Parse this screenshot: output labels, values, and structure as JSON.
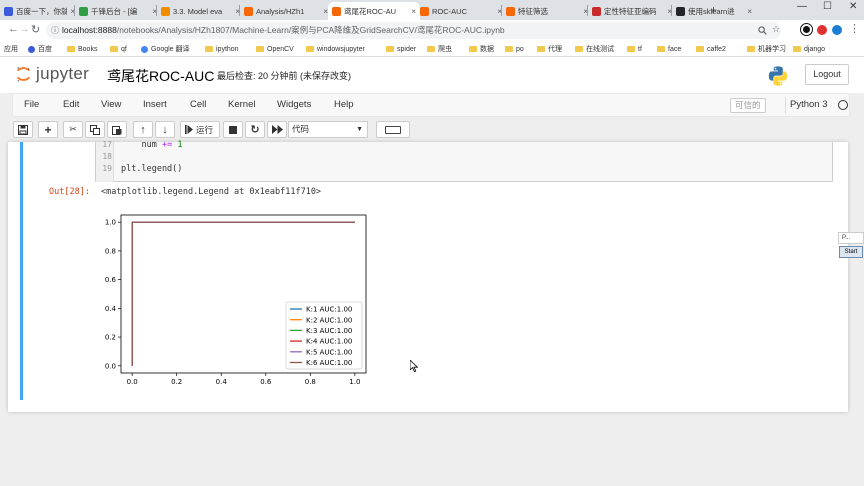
{
  "browser": {
    "tabs": [
      {
        "title": "百度一下，你就",
        "favicon_color": "#3b5bdb",
        "active": false
      },
      {
        "title": "千锋后台 - [编",
        "favicon_color": "#2f9e44",
        "active": false
      },
      {
        "title": "3.3. Model eva",
        "favicon_color": "#f08c00",
        "active": false
      },
      {
        "title": "Analysis/HZh1",
        "favicon_color": "#f76707",
        "active": false
      },
      {
        "title": "鸢尾花ROC-AU",
        "favicon_color": "#f76707",
        "active": true
      },
      {
        "title": "ROC-AUC",
        "favicon_color": "#f76707",
        "active": false
      },
      {
        "title": "特征筛选",
        "favicon_color": "#f76707",
        "active": false
      },
      {
        "title": "定性特征亚编码",
        "favicon_color": "#c92a2a",
        "active": false
      },
      {
        "title": "使用sklearn进",
        "favicon_color": "#212529",
        "active": false
      }
    ],
    "tab_close": "×",
    "new_tab": "+",
    "window_controls": [
      "—",
      "☐",
      "✕"
    ],
    "url_host": "localhost:8888",
    "url_path": "/notebooks/Analysis/HZh1807/Machine-Learn/案例与PCA降维及GridSearchCV/鸢尾花ROC-AUC.ipynb",
    "info_icon": "ⓘ",
    "bookmarks": [
      {
        "label": "应用",
        "kind": "apps"
      },
      {
        "label": "百度",
        "kind": "dot",
        "color": "#3b5bdb"
      },
      {
        "label": "Books",
        "kind": "folder"
      },
      {
        "label": "qf",
        "kind": "folder"
      },
      {
        "label": "Google 翻译",
        "kind": "dot",
        "color": "#4285f4"
      },
      {
        "label": "ipython",
        "kind": "folder"
      },
      {
        "label": "OpenCV",
        "kind": "folder"
      },
      {
        "label": "windowsjupyter",
        "kind": "folder"
      },
      {
        "label": "spider",
        "kind": "folder"
      },
      {
        "label": "爬虫",
        "kind": "folder"
      },
      {
        "label": "数据",
        "kind": "folder"
      },
      {
        "label": "po",
        "kind": "folder"
      },
      {
        "label": "代理",
        "kind": "folder"
      },
      {
        "label": "在线测试",
        "kind": "folder"
      },
      {
        "label": "tf",
        "kind": "folder"
      },
      {
        "label": "face",
        "kind": "folder"
      },
      {
        "label": "caffe2",
        "kind": "folder"
      },
      {
        "label": "机器学习",
        "kind": "folder"
      },
      {
        "label": "django",
        "kind": "folder"
      }
    ]
  },
  "jupyter": {
    "logo_text": "jupyter",
    "notebook_title": "鸢尾花ROC-AUC",
    "checkpoint": "最后检查: 20 分钟前  (未保存改变)",
    "logout_label": "Logout",
    "menu": [
      "File",
      "Edit",
      "View",
      "Insert",
      "Cell",
      "Kernel",
      "Widgets",
      "Help"
    ],
    "trusted_label": "可信的",
    "kernel_name": "Python 3",
    "toolbar": {
      "run_label": "运行",
      "cell_type": "代码"
    }
  },
  "cell": {
    "line_numbers": [
      "17",
      "18",
      "19"
    ],
    "code_lines": [
      {
        "text": "    num += 1",
        "kind": "aug"
      },
      {
        "text": "",
        "kind": "blank"
      },
      {
        "text": "plt.legend()",
        "kind": "plain"
      }
    ],
    "output_prompt": "Out[28]:",
    "output_text": "<matplotlib.legend.Legend at 0x1eabf11f710>"
  },
  "chart_data": {
    "type": "line",
    "title": "",
    "xlabel": "",
    "ylabel": "",
    "xlim": [
      -0.05,
      1.05
    ],
    "ylim": [
      -0.05,
      1.05
    ],
    "xticks": [
      "0.0",
      "0.2",
      "0.4",
      "0.6",
      "0.8",
      "1.0"
    ],
    "yticks": [
      "0.0",
      "0.2",
      "0.4",
      "0.6",
      "0.8",
      "1.0"
    ],
    "grid": false,
    "legend_position": "lower right",
    "series": [
      {
        "name": "K:1 AUC:1.00",
        "color": "#1f77b4",
        "x": [
          0,
          0,
          1
        ],
        "y": [
          0,
          1,
          1
        ]
      },
      {
        "name": "K:2 AUC:1.00",
        "color": "#ff7f0e",
        "x": [
          0,
          0,
          1
        ],
        "y": [
          0,
          1,
          1
        ]
      },
      {
        "name": "K:3 AUC:1.00",
        "color": "#2ca02c",
        "x": [
          0,
          0,
          1
        ],
        "y": [
          0,
          1,
          1
        ]
      },
      {
        "name": "K:4 AUC:1.00",
        "color": "#d62728",
        "x": [
          0,
          0,
          1
        ],
        "y": [
          0,
          1,
          1
        ]
      },
      {
        "name": "K:5 AUC:1.00",
        "color": "#9467bd",
        "x": [
          0,
          0,
          1
        ],
        "y": [
          0,
          1,
          1
        ]
      },
      {
        "name": "K:6 AUC:1.00",
        "color": "#8c564b",
        "x": [
          0,
          0,
          1
        ],
        "y": [
          0,
          1,
          1
        ]
      }
    ]
  },
  "side_widget": {
    "top_label": "P...",
    "button_label": "Start"
  },
  "colors": {
    "cell_selected_border": "#42a5f5",
    "output_prompt": "#d84315"
  }
}
